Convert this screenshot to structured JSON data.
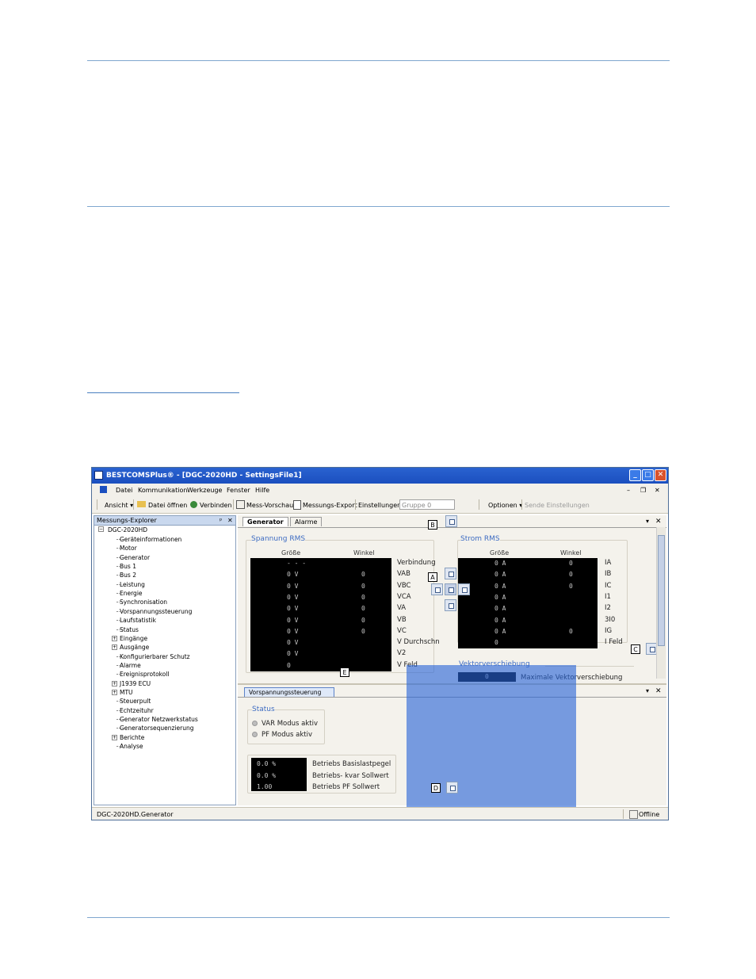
{
  "window": {
    "title": "BESTCOMSPlus® - [DGC-2020HD - SettingsFile1]",
    "minimize": "_",
    "maximize": "□",
    "close": "✕",
    "sub_minimize": "–",
    "sub_restore": "❐",
    "sub_close": "✕"
  },
  "menu": [
    "Datei",
    "Kommunikation",
    "Werkzeuge",
    "Fenster",
    "Hilfe"
  ],
  "toolbar": {
    "ansicht": "Ansicht ▾",
    "datei_oeffnen": "Datei öffnen",
    "verbinden": "Verbinden",
    "mess_vorschau": "Mess-Vorschau",
    "messungs_export": "Messungs-Export",
    "einstellungen": "Einstellungen",
    "gruppe": "Gruppe 0",
    "optionen": "Optionen ▾",
    "sende": "Sende Einstellungen"
  },
  "explorer": {
    "title": "Messungs-Explorer",
    "pin": "ᵖ",
    "close": "✕",
    "root": "DGC-2020HD",
    "items": [
      {
        "label": "Geräteinformationen",
        "exp": ""
      },
      {
        "label": "Motor",
        "exp": ""
      },
      {
        "label": "Generator",
        "exp": ""
      },
      {
        "label": "Bus 1",
        "exp": ""
      },
      {
        "label": "Bus 2",
        "exp": ""
      },
      {
        "label": "Leistung",
        "exp": ""
      },
      {
        "label": "Energie",
        "exp": ""
      },
      {
        "label": "Synchronisation",
        "exp": ""
      },
      {
        "label": "Vorspannungssteuerung",
        "exp": ""
      },
      {
        "label": "Laufstatistik",
        "exp": ""
      },
      {
        "label": "Status",
        "exp": ""
      },
      {
        "label": "Eingänge",
        "exp": "+"
      },
      {
        "label": "Ausgänge",
        "exp": "+"
      },
      {
        "label": "Konfigurierbarer Schutz",
        "exp": ""
      },
      {
        "label": "Alarme",
        "exp": ""
      },
      {
        "label": "Ereignisprotokoll",
        "exp": ""
      },
      {
        "label": "J1939 ECU",
        "exp": "+"
      },
      {
        "label": "MTU",
        "exp": "+"
      },
      {
        "label": "Steuerpult",
        "exp": ""
      },
      {
        "label": "Echtzeituhr",
        "exp": ""
      },
      {
        "label": "Generator Netzwerkstatus",
        "exp": ""
      },
      {
        "label": "Generatorsequenzierung",
        "exp": ""
      },
      {
        "label": "Berichte",
        "exp": "+"
      },
      {
        "label": "Analyse",
        "exp": ""
      }
    ]
  },
  "tabs": {
    "generator": "Generator",
    "alarme": "Alarme",
    "dropdown": "▾",
    "close": "✕"
  },
  "spannung": {
    "title": "Spannung RMS",
    "col_size": "Größe",
    "col_angle": "Winkel",
    "rows": [
      {
        "label": "Verbindung",
        "size": "- - -",
        "angle": ""
      },
      {
        "label": "VAB",
        "size": "0 V",
        "angle": "0"
      },
      {
        "label": "VBC",
        "size": "0 V",
        "angle": "0"
      },
      {
        "label": "VCA",
        "size": "0 V",
        "angle": "0"
      },
      {
        "label": "VA",
        "size": "0 V",
        "angle": "0"
      },
      {
        "label": "VB",
        "size": "0 V",
        "angle": "0"
      },
      {
        "label": "VC",
        "size": "0 V",
        "angle": "0"
      },
      {
        "label": "V Durchschn",
        "size": "0 V",
        "angle": ""
      },
      {
        "label": "V2",
        "size": "0 V",
        "angle": ""
      },
      {
        "label": "V Feld",
        "size": "0",
        "angle": ""
      }
    ]
  },
  "strom": {
    "title": "Strom RMS",
    "col_size": "Größe",
    "col_angle": "Winkel",
    "rows": [
      {
        "label": "IA",
        "size": "0 A",
        "angle": "0"
      },
      {
        "label": "IB",
        "size": "0 A",
        "angle": "0"
      },
      {
        "label": "IC",
        "size": "0 A",
        "angle": "0"
      },
      {
        "label": "I1",
        "size": "0 A",
        "angle": ""
      },
      {
        "label": "I2",
        "size": "0 A",
        "angle": ""
      },
      {
        "label": "3I0",
        "size": "0 A",
        "angle": ""
      },
      {
        "label": "IG",
        "size": "0 A",
        "angle": "0"
      },
      {
        "label": "I Feld",
        "size": "0",
        "angle": ""
      }
    ]
  },
  "vektor": {
    "title": "Vektorverschiebung",
    "value": "0",
    "label": "Maximale Vektorverschiebung"
  },
  "bottom": {
    "tab": "Vorspannungssteuerung",
    "status_title": "Status",
    "status_items": [
      "VAR Modus aktiv",
      "PF Modus aktiv"
    ],
    "betrieb": [
      {
        "value": "0.0 %",
        "label": "Betriebs Basislastpegel"
      },
      {
        "value": "0.0 %",
        "label": "Betriebs- kvar Sollwert"
      },
      {
        "value": "1.00",
        "label": "Betriebs PF Sollwert"
      }
    ]
  },
  "callouts": {
    "a": "A",
    "b": "B",
    "c": "C",
    "d": "D",
    "e": "E"
  },
  "statusbar": {
    "left": "DGC-2020HD.Generator",
    "right": "Offline"
  }
}
